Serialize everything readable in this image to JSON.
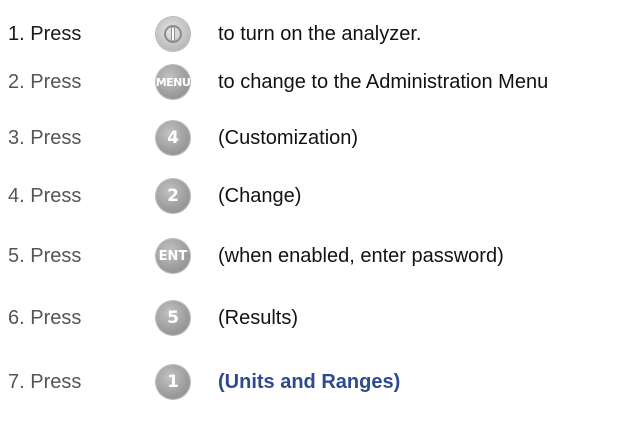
{
  "steps": [
    {
      "label": "1. Press",
      "key": "power-icon",
      "key_text": "",
      "description": "to turn on the analyzer."
    },
    {
      "label": "2. Press",
      "key": "menu-key",
      "key_text": "MENU",
      "description": "to change to the Administration Menu"
    },
    {
      "label": "3. Press",
      "key": "key-4",
      "key_text": "4",
      "description": "(Customization)"
    },
    {
      "label": "4. Press",
      "key": "key-2",
      "key_text": "2",
      "description": "(Change)"
    },
    {
      "label": "5. Press",
      "key": "enter-key",
      "key_text": "ENT",
      "description": "(when enabled, enter password)"
    },
    {
      "label": "6. Press",
      "key": "key-5",
      "key_text": "5",
      "description": "(Results)"
    },
    {
      "label": "7. Press",
      "key": "key-1",
      "key_text": "1",
      "description": "(Units and Ranges)"
    }
  ],
  "colors": {
    "highlight_text": "#2e4a8f",
    "key_fill": "#9c9c9c",
    "key_text": "#ffffff"
  }
}
